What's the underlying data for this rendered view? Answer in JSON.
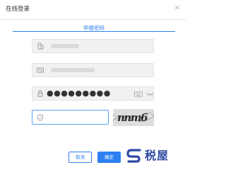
{
  "dialog": {
    "title": "在线登录",
    "close_label": "×"
  },
  "tab": {
    "label": "申报密码"
  },
  "fields": {
    "tax_id": {
      "icon": "building-icon"
    },
    "id_number": {
      "icon": "id-card-icon"
    },
    "password": {
      "icon": "lock-icon",
      "masked_value": "●●●●●●●●●"
    },
    "captcha": {
      "icon": "shield-icon",
      "value": "",
      "image_text": "nnm6"
    }
  },
  "buttons": {
    "cancel": "取消",
    "confirm": "确定"
  },
  "watermark": {
    "text": "税屋"
  },
  "colors": {
    "accent": "#2e7ff0",
    "watermark": "#2f4aa3"
  }
}
